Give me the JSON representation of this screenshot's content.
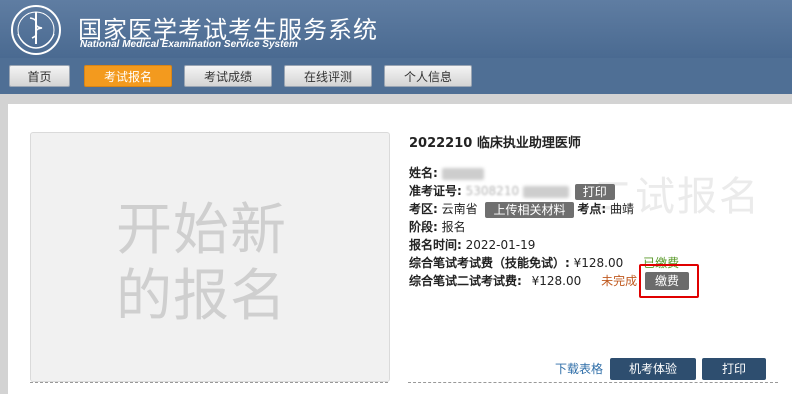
{
  "header": {
    "site_title": "国家医学考试考生服务系统",
    "site_subtitle": "National Medical Examination Service System",
    "logo": "national-medical-exam-emblem"
  },
  "nav": {
    "tabs": [
      {
        "label": "首页",
        "active": false
      },
      {
        "label": "考试报名",
        "active": true
      },
      {
        "label": "考试成绩",
        "active": false
      },
      {
        "label": "在线评测",
        "active": false
      },
      {
        "label": "个人信息",
        "active": false
      }
    ]
  },
  "photo": {
    "placeholder_text": "开始新的报名"
  },
  "exam": {
    "title": "2022210 临床执业助理医师",
    "watermark": "二试报名",
    "name_label": "姓名:",
    "admission_label": "准考证号:",
    "admission_partial": "5308210",
    "print_label": "打印",
    "region_label": "考区:",
    "region_value": "云南省",
    "upload_label": "上传相关材料",
    "site_label": "考点:",
    "site_value": "曲靖",
    "stage_label": "阶段:",
    "stage_value": "报名",
    "reg_time_label": "报名时间:",
    "reg_time_value": "2022-01-19",
    "fee1_label": "综合笔试考试费（技能免试）:",
    "fee1_amount": "¥128.00",
    "fee1_status": "已缴费",
    "fee2_label": "综合笔试二试考试费:",
    "fee2_amount": "¥128.00",
    "fee2_status": "未完成",
    "pay_label": "缴费"
  },
  "footer": {
    "download_label": "下载表格",
    "trial_label": "机考体验",
    "print_label": "打印"
  },
  "colors": {
    "header_bg": "#4f6f95",
    "active_tab": "#f39a1e",
    "paid": "#5a9a2a",
    "unpaid": "#c05a20",
    "highlight": "#e00000",
    "navy_button": "#2e4e6f"
  }
}
